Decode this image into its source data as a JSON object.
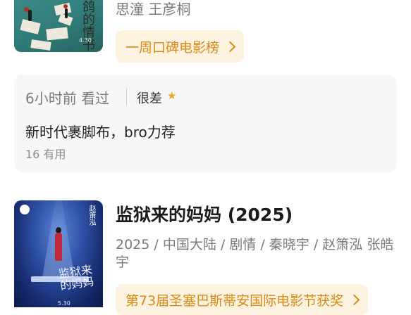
{
  "movie_prev": {
    "people": "思潼 王彦桐",
    "chip_label": "一周口碑电影榜",
    "poster": {
      "title_text": "鸽的情书",
      "date": "4.30"
    }
  },
  "review": {
    "time_label": "6小时前 看过",
    "verdict": "很差",
    "star_icon": "★",
    "text": "新时代裹脚布，bro力荐",
    "helpful": "16 有用"
  },
  "movie_next": {
    "title": "监狱来的妈妈 (2025)",
    "meta": "2025 / 中国大陆 / 剧情 / 秦晓宇 / 赵箫泓 张皓宇",
    "chip_label": "第73届圣塞巴斯蒂安国际电影节获奖",
    "poster": {
      "title_text": "监狱来的妈妈",
      "side_text": "赵箫泓",
      "date": "5.30"
    }
  },
  "colors": {
    "accent": "#d98a15",
    "chip_bg": "#fdf3e0",
    "card_bg": "#f7f7f7",
    "star": "#f2a322"
  }
}
